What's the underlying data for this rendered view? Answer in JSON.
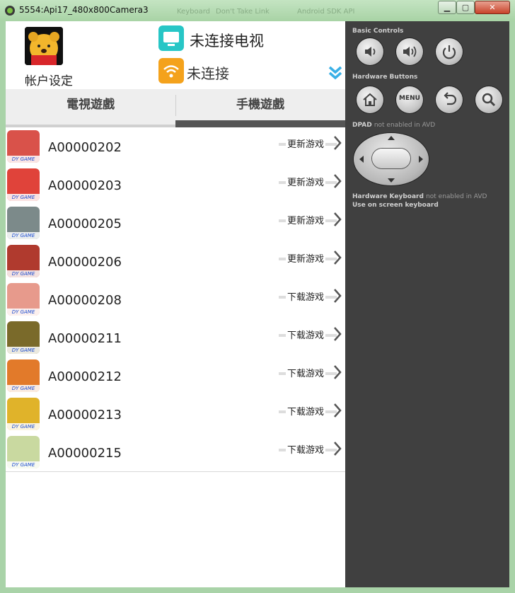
{
  "window": {
    "title": "5554:Api17_480x800Camera3",
    "ghost_items": [
      "Keyboard",
      "Don't Take Link",
      "Android SDK API"
    ]
  },
  "header": {
    "account_label": "帐户设定",
    "tv_status": "未连接电视",
    "wifi_status": "未连接"
  },
  "tabs": [
    {
      "label": "電視遊戲",
      "active": false
    },
    {
      "label": "手機遊戲",
      "active": true
    }
  ],
  "games": [
    {
      "id": "A00000202",
      "action": "更新游戏",
      "color": "#d9524a"
    },
    {
      "id": "A00000203",
      "action": "更新游戏",
      "color": "#e0433a"
    },
    {
      "id": "A00000205",
      "action": "更新游戏",
      "color": "#7c8a8a"
    },
    {
      "id": "A00000206",
      "action": "更新游戏",
      "color": "#b03a2e"
    },
    {
      "id": "A00000208",
      "action": "下载游戏",
      "color": "#e79a8c"
    },
    {
      "id": "A00000211",
      "action": "下载游戏",
      "color": "#7a6a2a"
    },
    {
      "id": "A00000212",
      "action": "下载游戏",
      "color": "#e27a2a"
    },
    {
      "id": "A00000213",
      "action": "下载游戏",
      "color": "#e0b32a"
    },
    {
      "id": "A00000215",
      "action": "下载游戏",
      "color": "#c9d9a0"
    }
  ],
  "icon_badge": "DY GAME",
  "controls": {
    "basic_label": "Basic Controls",
    "hardware_label": "Hardware Buttons",
    "menu_label": "MENU",
    "dpad_label": "DPAD",
    "dpad_note": "not enabled in AVD",
    "keyboard_label": "Hardware Keyboard",
    "keyboard_note": "not enabled in AVD",
    "onscreen_label": "Use on screen keyboard"
  }
}
